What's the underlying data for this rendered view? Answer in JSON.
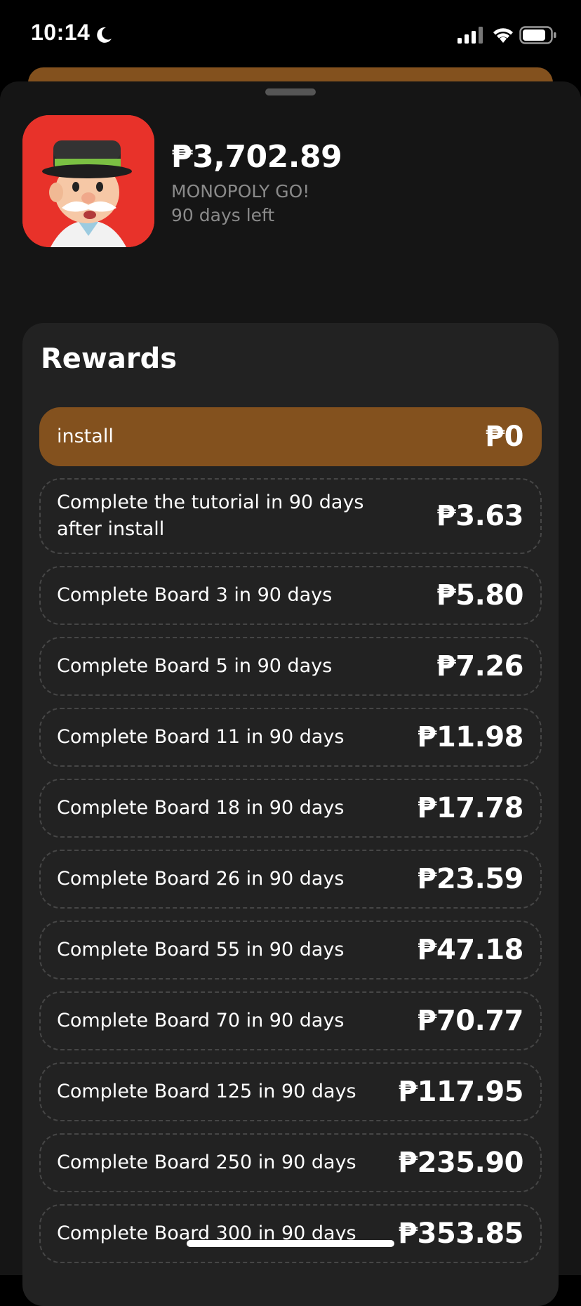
{
  "status_bar": {
    "time": "10:14",
    "icons": [
      "moon-icon",
      "signal-icon",
      "wifi-icon",
      "battery-icon"
    ]
  },
  "app": {
    "total_amount": "₱3,702.89",
    "name": "MONOPOLY GO!",
    "days_left": "90 days left",
    "icon": "monopoly-go-app-icon"
  },
  "rewards": {
    "title": "Rewards",
    "items": [
      {
        "label": "install",
        "value": "₱0",
        "active": true
      },
      {
        "label": "Complete the tutorial in 90 days after install",
        "value": "₱3.63"
      },
      {
        "label": "Complete Board 3 in 90 days",
        "value": "₱5.80"
      },
      {
        "label": "Complete Board 5 in 90 days",
        "value": "₱7.26"
      },
      {
        "label": "Complete Board 11 in 90 days",
        "value": "₱11.98"
      },
      {
        "label": "Complete Board 18 in 90 days",
        "value": "₱17.78"
      },
      {
        "label": "Complete Board 26 in 90 days",
        "value": "₱23.59"
      },
      {
        "label": "Complete Board 55 in 90 days",
        "value": "₱47.18"
      },
      {
        "label": "Complete Board 70 in 90 days",
        "value": "₱70.77"
      },
      {
        "label": "Complete Board 125 in 90 days",
        "value": "₱117.95"
      },
      {
        "label": "Complete Board 250 in 90 days",
        "value": "₱235.90"
      },
      {
        "label": "Complete Board 300 in 90 days",
        "value": "₱353.85"
      }
    ]
  },
  "colors": {
    "accent": "#83511e",
    "sheet_background": "#151515",
    "card_background": "#222222",
    "muted_text": "#8a8a8a"
  }
}
